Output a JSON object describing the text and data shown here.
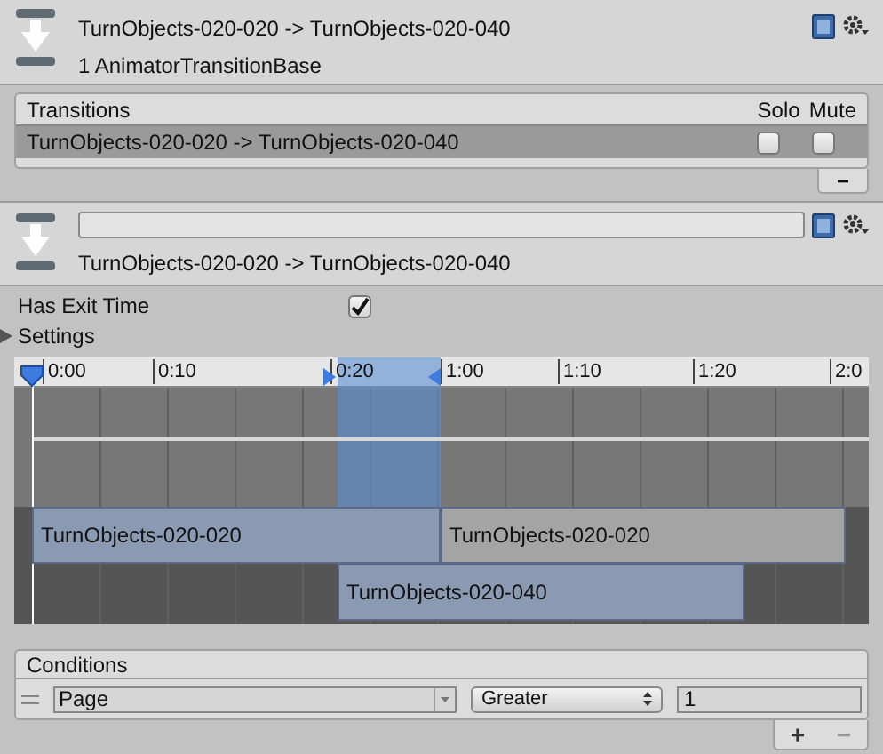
{
  "header": {
    "title": "TurnObjects-020-020 -> TurnObjects-020-040",
    "subtitle": "1 AnimatorTransitionBase"
  },
  "transitions": {
    "title": "Transitions",
    "columns": [
      "Solo",
      "Mute"
    ],
    "rows": [
      {
        "name": "TurnObjects-020-020 -> TurnObjects-020-040",
        "selected": true,
        "solo": false,
        "mute": false
      }
    ],
    "remove_button": "−"
  },
  "transition": {
    "label": "TurnObjects-020-020 -> TurnObjects-020-040"
  },
  "has_exit_time": {
    "label": "Has Exit Time",
    "checked": true
  },
  "settings": {
    "label": "Settings",
    "expanded": false
  },
  "timeline": {
    "ticks": [
      "0:00",
      "0:10",
      "0:20",
      "1:00",
      "1:10",
      "1:20",
      "2:0"
    ],
    "clips": [
      {
        "label": "TurnObjects-020-020",
        "kind": "source"
      },
      {
        "label": "TurnObjects-020-020",
        "kind": "next"
      },
      {
        "label": "TurnObjects-020-040",
        "kind": "destination"
      }
    ]
  },
  "conditions": {
    "title": "Conditions",
    "rows": [
      {
        "parameter": "Page",
        "operator": "Greater",
        "value": "1"
      }
    ],
    "add_button": "+",
    "remove_button": "−"
  }
}
